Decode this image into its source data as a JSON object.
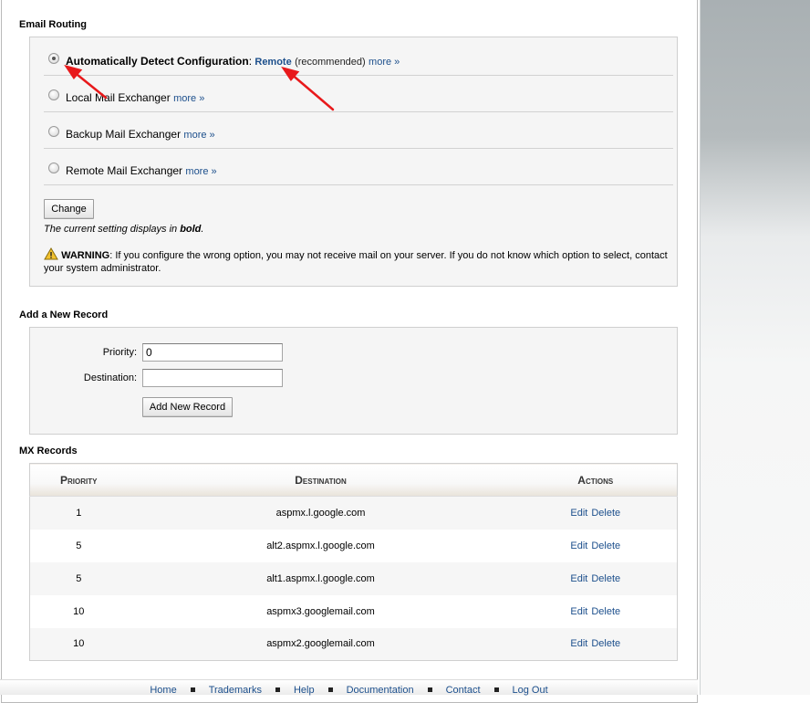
{
  "email_routing": {
    "title": "Email Routing",
    "options": [
      {
        "label": "Automatically Detect Configuration",
        "suffix_colon": ":",
        "detected": "Remote",
        "recommended": "(recommended)",
        "more": "more »",
        "checked": true
      },
      {
        "label": "Local Mail Exchanger",
        "more": "more »",
        "checked": false
      },
      {
        "label": "Backup Mail Exchanger",
        "more": "more »",
        "checked": false
      },
      {
        "label": "Remote Mail Exchanger",
        "more": "more »",
        "checked": false
      }
    ],
    "change_button": "Change",
    "note_prefix": "The current setting displays in ",
    "note_bold": "bold",
    "note_suffix": ".",
    "warning_label": "WARNING",
    "warning_text": ": If you configure the wrong option, you may not receive mail on your server. If you do not know which option to select, contact your system administrator."
  },
  "add_record": {
    "title": "Add a New Record",
    "priority_label": "Priority:",
    "priority_value": "0",
    "destination_label": "Destination:",
    "destination_value": "",
    "submit_button": "Add New Record"
  },
  "mx_records": {
    "title": "MX Records",
    "columns": [
      "Priority",
      "Destination",
      "Actions"
    ],
    "rows": [
      {
        "priority": "1",
        "destination": "aspmx.l.google.com",
        "edit": "Edit",
        "delete": "Delete"
      },
      {
        "priority": "5",
        "destination": "alt2.aspmx.l.google.com",
        "edit": "Edit",
        "delete": "Delete"
      },
      {
        "priority": "5",
        "destination": "alt1.aspmx.l.google.com",
        "edit": "Edit",
        "delete": "Delete"
      },
      {
        "priority": "10",
        "destination": "aspmx3.googlemail.com",
        "edit": "Edit",
        "delete": "Delete"
      },
      {
        "priority": "10",
        "destination": "aspmx2.googlemail.com",
        "edit": "Edit",
        "delete": "Delete"
      }
    ]
  },
  "footer": {
    "links": [
      "Home",
      "Trademarks",
      "Help",
      "Documentation",
      "Contact",
      "Log Out"
    ]
  },
  "colors": {
    "link": "#1c4f8c",
    "annotation_arrow": "#e8191b",
    "warning_icon": "#f2c230"
  }
}
